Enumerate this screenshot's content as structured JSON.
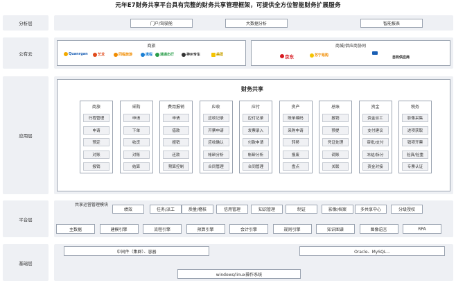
{
  "title": "元年E7财务共享平台具有完整的财务共享管理框架，可提供全方位智能财务扩展服务",
  "layers": {
    "analysis": "分析层",
    "public_cloud": "公有云",
    "application": "应用层",
    "platform": "平台层",
    "foundation": "基础层"
  },
  "analysis_items": [
    "门户/驾驶舱",
    "大数据分析",
    "智能报表"
  ],
  "public_cloud": {
    "travel_title": "商旅",
    "mall_title": "商城/供应商协同",
    "travel_logos": [
      "Quanrgan",
      "艺龙",
      "同程旅游",
      "携程",
      "通通出行",
      "神州专车",
      "美团"
    ],
    "mall_logos": [
      "京东",
      "苏宁易购",
      "自有供应商"
    ]
  },
  "core_title": "财务共享",
  "modules": [
    {
      "name": "商旅",
      "items": [
        "行程管理",
        "申请",
        "预定",
        "对账",
        "报销"
      ]
    },
    {
      "name": "采购",
      "items": [
        "申请",
        "下单",
        "收货",
        "对账",
        "结算"
      ]
    },
    {
      "name": "费用报销",
      "items": [
        "申请",
        "借款",
        "报销",
        "还款",
        "预算控制"
      ]
    },
    {
      "name": "应收",
      "items": [
        "应收记录",
        "开票申请",
        "应收确认",
        "帐龄分析",
        "合同管理"
      ]
    },
    {
      "name": "应付",
      "items": [
        "应付记录",
        "发票录入",
        "付款申请",
        "帐龄分析",
        "合同管理"
      ]
    },
    {
      "name": "资产",
      "items": [
        "账单编码",
        "采购申请",
        "转移",
        "报废",
        "盘点"
      ]
    },
    {
      "name": "总账",
      "items": [
        "报销",
        "预提",
        "凭证处理",
        "调账",
        "关联"
      ]
    },
    {
      "name": "资金",
      "items": [
        "资金派工",
        "支付建议",
        "审批/支付",
        "冻结/拆分",
        "资金对接"
      ]
    },
    {
      "name": "税务",
      "items": [
        "影像采集",
        "进项获取",
        "销项开票",
        "验真/验重",
        "专票认证"
      ]
    }
  ],
  "platform": {
    "ops_label": "共享运营管理模块",
    "ops_items": [
      "绩效",
      "任务/派工",
      "质量/稽核",
      "信用管理",
      "知识管理",
      "制证",
      "影像/档案",
      "多共享中心",
      "分级授权"
    ],
    "engines": [
      "主数据",
      "建模引擎",
      "流程引擎",
      "预算引擎",
      "会计引擎",
      "规则引擎",
      "知识图谱",
      "图像语言",
      "RPA"
    ]
  },
  "foundation": {
    "middleware": "中间件（集群）、容器",
    "database": "Oracle、MySQL...",
    "os": "windows/linux操作系统"
  },
  "colors": {
    "band": "#eef0f4",
    "border": "#9aa3b0",
    "item_bg": "#f0f1f4"
  }
}
